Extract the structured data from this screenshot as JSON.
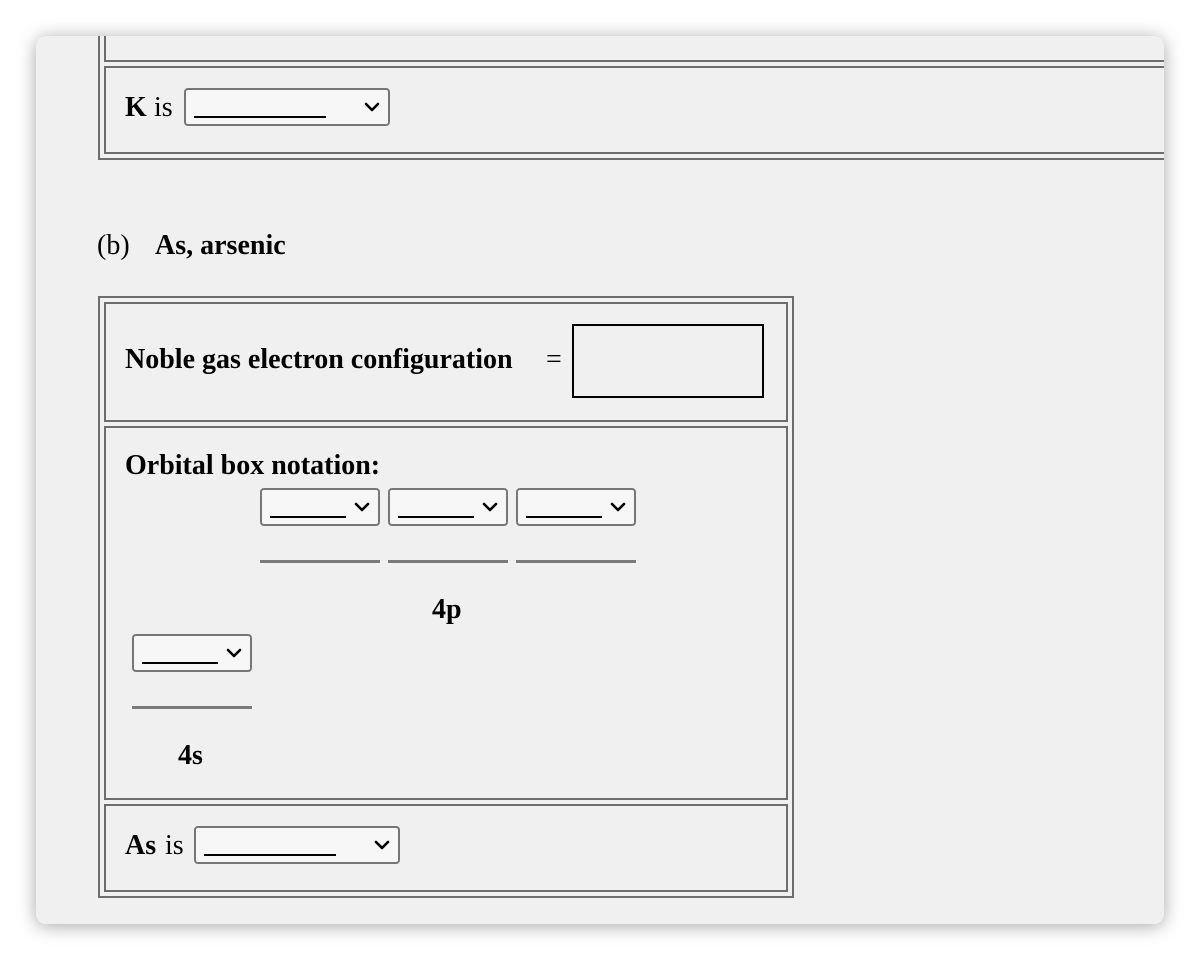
{
  "part_a": {
    "k_label": "K",
    "k_is": "is",
    "k_select_value": "________"
  },
  "part_b": {
    "letter": "(b)",
    "title": "As, arsenic",
    "noble_gas_label": "Noble gas electron configuration",
    "equals": "=",
    "noble_gas_value": "",
    "orbital_box_label": "Orbital box notation:",
    "orbital_4p_label": "4p",
    "orbital_4s_label": "4s",
    "as_label": "As",
    "as_is": "is",
    "as_select_value": "________"
  },
  "icons": {
    "dropdown": "chevron-down-icon"
  }
}
